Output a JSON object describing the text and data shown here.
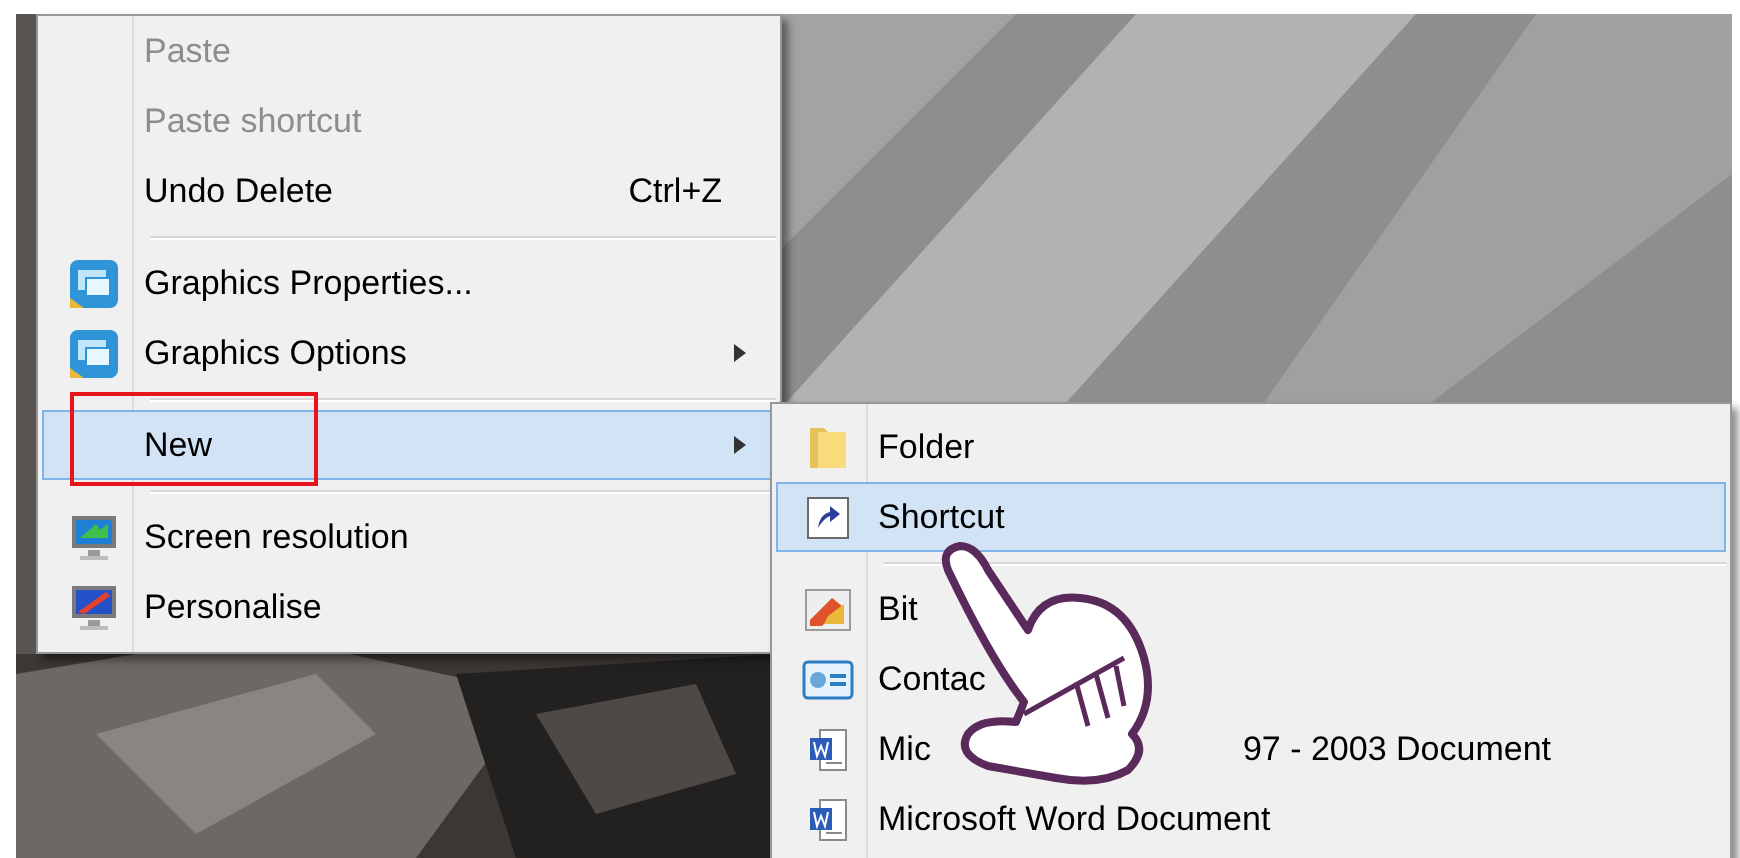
{
  "context_menu": {
    "items": [
      {
        "kind": "item",
        "label": "Paste",
        "disabled": true,
        "has_submenu": false,
        "selected": false
      },
      {
        "kind": "item",
        "label": "Paste shortcut",
        "disabled": true,
        "has_submenu": false,
        "selected": false
      },
      {
        "kind": "item",
        "label": "Undo Delete",
        "shortcut": "Ctrl+Z",
        "disabled": false,
        "has_submenu": false,
        "selected": false
      },
      {
        "kind": "separator"
      },
      {
        "kind": "item",
        "label": "Graphics Properties...",
        "disabled": false,
        "has_submenu": false,
        "selected": false
      },
      {
        "kind": "item",
        "label": "Graphics Options",
        "disabled": false,
        "has_submenu": true,
        "selected": false
      },
      {
        "kind": "separator"
      },
      {
        "kind": "item",
        "label": "New",
        "disabled": false,
        "has_submenu": true,
        "selected": true
      },
      {
        "kind": "separator"
      },
      {
        "kind": "item",
        "label": "Screen resolution",
        "disabled": false,
        "has_submenu": false,
        "selected": false
      },
      {
        "kind": "item",
        "label": "Personalise",
        "disabled": false,
        "has_submenu": false,
        "selected": false
      }
    ]
  },
  "new_submenu": {
    "items": [
      {
        "kind": "item",
        "label": "Folder",
        "selected": false
      },
      {
        "kind": "item",
        "label": "Shortcut",
        "selected": true
      },
      {
        "kind": "separator"
      },
      {
        "kind": "item",
        "label": "Bit",
        "selected": false
      },
      {
        "kind": "item",
        "label": "Contac",
        "selected": false
      },
      {
        "kind": "item",
        "label": "Mic",
        "label_continued": "97 - 2003 Document",
        "selected": false
      },
      {
        "kind": "item",
        "label": "Microsoft Word Document",
        "selected": false
      }
    ]
  }
}
